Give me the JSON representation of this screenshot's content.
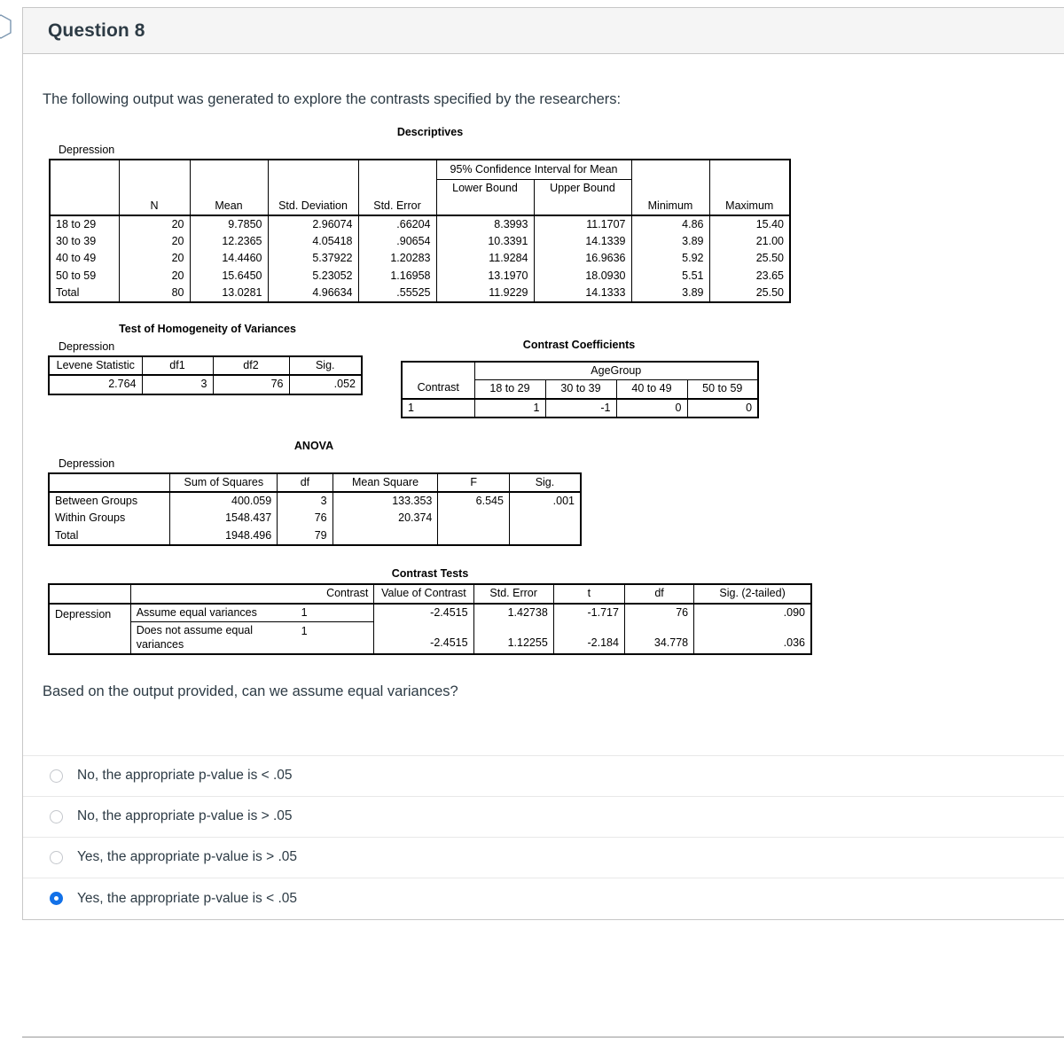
{
  "header": {
    "title": "Question 8"
  },
  "intro": "The following output was generated to explore the contrasts specified by the researchers:",
  "question": "Based on the output provided, can we assume equal variances?",
  "colors": {
    "accent": "#1271e8",
    "header_bg": "#f5f5f5",
    "border": "#c7c7c7",
    "text": "#2d3b45"
  },
  "descriptives": {
    "title": "Descriptives",
    "caption": "Depression",
    "group_header": "95% Confidence Interval for Mean",
    "columns": [
      "",
      "N",
      "Mean",
      "Std. Deviation",
      "Std. Error",
      "Lower Bound",
      "Upper Bound",
      "Minimum",
      "Maximum"
    ],
    "rows": [
      {
        "label": "18 to 29",
        "n": "20",
        "mean": "9.7850",
        "sd": "2.96074",
        "se": ".66204",
        "lower": "8.3993",
        "upper": "11.1707",
        "min": "4.86",
        "max": "15.40"
      },
      {
        "label": "30 to 39",
        "n": "20",
        "mean": "12.2365",
        "sd": "4.05418",
        "se": ".90654",
        "lower": "10.3391",
        "upper": "14.1339",
        "min": "3.89",
        "max": "21.00"
      },
      {
        "label": "40 to 49",
        "n": "20",
        "mean": "14.4460",
        "sd": "5.37922",
        "se": "1.20283",
        "lower": "11.9284",
        "upper": "16.9636",
        "min": "5.92",
        "max": "25.50"
      },
      {
        "label": "50 to 59",
        "n": "20",
        "mean": "15.6450",
        "sd": "5.23052",
        "se": "1.16958",
        "lower": "13.1970",
        "upper": "18.0930",
        "min": "5.51",
        "max": "23.65"
      },
      {
        "label": "Total",
        "n": "80",
        "mean": "13.0281",
        "sd": "4.96634",
        "se": ".55525",
        "lower": "11.9229",
        "upper": "14.1333",
        "min": "3.89",
        "max": "25.50"
      }
    ]
  },
  "levene": {
    "title": "Test of Homogeneity of Variances",
    "caption": "Depression",
    "columns": [
      "Levene Statistic",
      "df1",
      "df2",
      "Sig."
    ],
    "row": {
      "statistic": "2.764",
      "df1": "3",
      "df2": "76",
      "sig": ".052"
    }
  },
  "contrast_coefficients": {
    "title": "Contrast Coefficients",
    "group_header": "AgeGroup",
    "contrast_label": "Contrast",
    "columns": [
      "18 to 29",
      "30 to 39",
      "40 to 49",
      "50 to 59"
    ],
    "rows": [
      {
        "contrast": "1",
        "c1": "1",
        "c2": "-1",
        "c3": "0",
        "c4": "0"
      }
    ]
  },
  "anova": {
    "title": "ANOVA",
    "caption": "Depression",
    "columns": [
      "",
      "Sum of Squares",
      "df",
      "Mean Square",
      "F",
      "Sig."
    ],
    "rows": [
      {
        "label": "Between Groups",
        "ss": "400.059",
        "df": "3",
        "ms": "133.353",
        "f": "6.545",
        "sig": ".001"
      },
      {
        "label": "Within Groups",
        "ss": "1548.437",
        "df": "76",
        "ms": "20.374",
        "f": "",
        "sig": ""
      },
      {
        "label": "Total",
        "ss": "1948.496",
        "df": "79",
        "ms": "",
        "f": "",
        "sig": ""
      }
    ]
  },
  "contrast_tests": {
    "title": "Contrast Tests",
    "columns": [
      "",
      "",
      "Contrast",
      "Value of Contrast",
      "Std. Error",
      "t",
      "df",
      "Sig. (2-tailed)"
    ],
    "row_group_label": "Depression",
    "rows": [
      {
        "assumption": "Assume equal variances",
        "contrast": "1",
        "value": "-2.4515",
        "se": "1.42738",
        "t": "-1.717",
        "df": "76",
        "sig": ".090"
      },
      {
        "assumption": "Does not assume equal variances",
        "contrast": "1",
        "value": "-2.4515",
        "se": "1.12255",
        "t": "-2.184",
        "df": "34.778",
        "sig": ".036"
      }
    ]
  },
  "answers": [
    {
      "label": "No, the appropriate p-value is < .05",
      "selected": false
    },
    {
      "label": "No, the appropriate p-value is > .05",
      "selected": false
    },
    {
      "label": "Yes, the appropriate p-value is > .05",
      "selected": false
    },
    {
      "label": "Yes, the appropriate p-value is < .05",
      "selected": true
    }
  ]
}
